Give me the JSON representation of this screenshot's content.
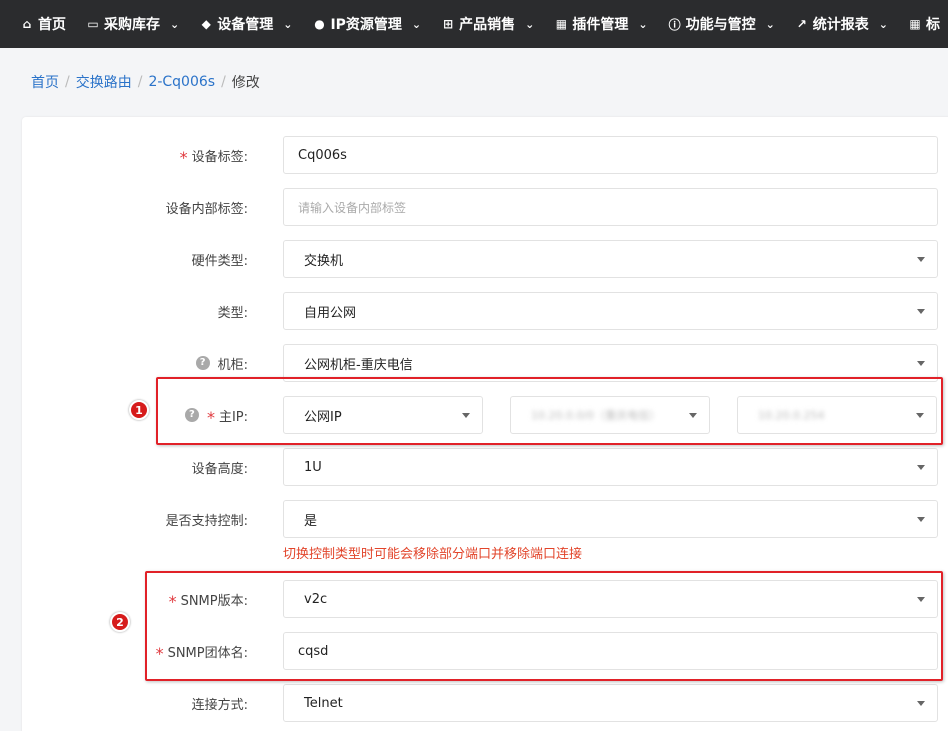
{
  "nav": {
    "items": [
      {
        "icon": "home-icon",
        "glyph": "⌂",
        "label": "首页",
        "has_caret": false
      },
      {
        "icon": "inbox-icon",
        "glyph": "▭",
        "label": "采购库存",
        "has_caret": true
      },
      {
        "icon": "cube-icon",
        "glyph": "◆",
        "label": "设备管理",
        "has_caret": true
      },
      {
        "icon": "map-marker-icon",
        "glyph": "●",
        "label": "IP资源管理",
        "has_caret": true
      },
      {
        "icon": "cart-icon",
        "glyph": "⊞",
        "label": "产品销售",
        "has_caret": true
      },
      {
        "icon": "grid-icon",
        "glyph": "▦",
        "label": "插件管理",
        "has_caret": true
      },
      {
        "icon": "info-icon",
        "glyph": "ⓘ",
        "label": "功能与管控",
        "has_caret": true
      },
      {
        "icon": "line-chart-icon",
        "glyph": "↗",
        "label": "统计报表",
        "has_caret": true
      },
      {
        "icon": "table-icon",
        "glyph": "▦",
        "label": "标",
        "has_caret": false
      }
    ],
    "caret_glyph": "⌄"
  },
  "breadcrumb": {
    "home": "首页",
    "section": "交换路由",
    "device": "2-Cq006s",
    "current": "修改",
    "sep": "/"
  },
  "form": {
    "device_label": {
      "label": "设备标签:",
      "value": "Cq006s"
    },
    "inner_label": {
      "label": "设备内部标签:",
      "placeholder": "请输入设备内部标签"
    },
    "hardware_type": {
      "label": "硬件类型:",
      "value": "交换机"
    },
    "type": {
      "label": "类型:",
      "value": "自用公网"
    },
    "cabinet": {
      "label": "机柜:",
      "value": "公网机柜-重庆电信"
    },
    "main_ip": {
      "label": "主IP:",
      "kind": "公网IP",
      "pool": "10.20.0.0/0（重庆电信）",
      "address": "10.20.0.254"
    },
    "height": {
      "label": "设备高度:",
      "value": "1U"
    },
    "control": {
      "label": "是否支持控制:",
      "value": "是",
      "hint": "切换控制类型时可能会移除部分端口并移除端口连接"
    },
    "snmp_version": {
      "label": "SNMP版本:",
      "value": "v2c"
    },
    "snmp_community": {
      "label": "SNMP团体名:",
      "value": "cqsd"
    },
    "connection": {
      "label": "连接方式:",
      "value": "Telnet"
    }
  },
  "annotations": {
    "first": "1",
    "second": "2",
    "color": "#e12128"
  },
  "required_mark": "*",
  "help_glyph": "?"
}
